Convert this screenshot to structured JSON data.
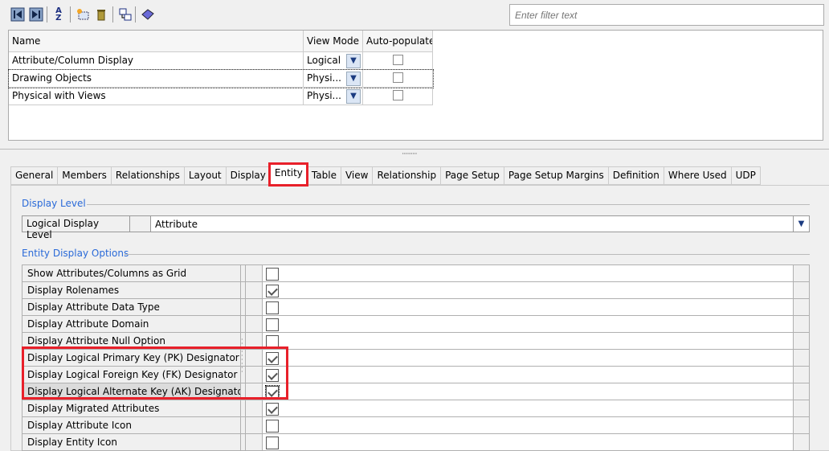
{
  "toolbar": {
    "icons": [
      "move-left-icon",
      "move-right-icon",
      "sort-az-icon",
      "new-item-icon",
      "delete-icon",
      "copy-icon",
      "book-icon"
    ]
  },
  "filter": {
    "placeholder": "Enter filter text"
  },
  "top_table": {
    "columns": [
      "Name",
      "View Mode",
      "Auto-populate"
    ],
    "rows": [
      {
        "name": "Attribute/Column Display",
        "view_mode": "Logical",
        "auto": false
      },
      {
        "name": "Drawing Objects",
        "view_mode": "Physi...",
        "auto": false
      },
      {
        "name": "Physical with Views",
        "view_mode": "Physi...",
        "auto": false
      }
    ]
  },
  "tabs": [
    "General",
    "Members",
    "Relationships",
    "Layout",
    "Display",
    "Entity",
    "Table",
    "View",
    "Relationship",
    "Page Setup",
    "Page Setup Margins",
    "Definition",
    "Where Used",
    "UDP"
  ],
  "active_tab": "Entity",
  "display_level": {
    "section": "Display Level",
    "label": "Logical Display Level",
    "value": "Attribute"
  },
  "entity_options": {
    "section": "Entity Display Options",
    "rows": [
      {
        "label": "Show Attributes/Columns as Grid",
        "checked": false
      },
      {
        "label": "Display Rolenames",
        "checked": true
      },
      {
        "label": "Display Attribute Data Type",
        "checked": false
      },
      {
        "label": "Display Attribute Domain",
        "checked": false
      },
      {
        "label": "Display Attribute Null Option",
        "checked": false
      },
      {
        "label": "Display Logical Primary Key (PK) Designator",
        "checked": true
      },
      {
        "label": "Display Logical Foreign Key (FK) Designator",
        "checked": true
      },
      {
        "label": "Display Logical Alternate Key (AK) Designator",
        "checked": true
      },
      {
        "label": "Display Migrated Attributes",
        "checked": true
      },
      {
        "label": "Display Attribute Icon",
        "checked": false
      },
      {
        "label": "Display Entity Icon",
        "checked": false
      }
    ]
  },
  "colors": {
    "highlight": "#e8202a",
    "section": "#2a6ad8"
  }
}
